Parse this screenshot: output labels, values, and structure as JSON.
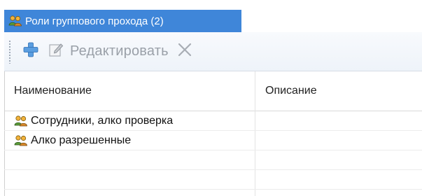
{
  "window": {
    "title": "Роли группового прохода (2)",
    "icon": "users-group-icon"
  },
  "toolbar": {
    "add_icon": "plus-icon",
    "edit_icon": "edit-icon",
    "edit_label": "Редактировать",
    "delete_icon": "close-icon"
  },
  "table": {
    "columns": [
      "Наименование",
      "Описание"
    ],
    "rows": [
      {
        "name": "Сотрудники, алко проверка",
        "description": "",
        "icon": "users-group-icon"
      },
      {
        "name": "Алко разрешенные",
        "description": "",
        "icon": "users-group-icon"
      }
    ]
  },
  "colors": {
    "title_bg": "#3f86d9",
    "title_text": "#ffffff",
    "add_icon": "#4d8fd6"
  }
}
